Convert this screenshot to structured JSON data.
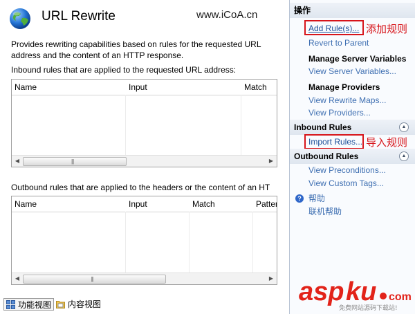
{
  "main": {
    "title": "URL Rewrite",
    "watermark": "www.iCoA.cn",
    "description": "Provides rewriting capabilities based on rules for the requested URL address and the content of an HTTP response.",
    "inbound_label": "Inbound rules that are applied to the requested URL address:",
    "inbound_columns": [
      "Name",
      "Input",
      "Match"
    ],
    "outbound_label": "Outbound rules that are applied to the headers or the content of an HT",
    "outbound_columns": [
      "Name",
      "Input",
      "Match",
      "Patter"
    ]
  },
  "bottom_tabs": {
    "feature_view": "功能视图",
    "content_view": "内容视图"
  },
  "actions": {
    "header": "操作",
    "add_rules": "Add Rule(s)...",
    "add_rules_note": "添加规则",
    "revert_to_parent": "Revert to Parent",
    "manage_server_variables": "Manage Server Variables",
    "view_server_variables": "View Server Variables...",
    "manage_providers": "Manage Providers",
    "view_rewrite_maps": "View Rewrite Maps...",
    "view_providers": "View Providers...",
    "inbound_rules": "Inbound Rules",
    "import_rules": "Import Rules...",
    "import_rules_note": "导入规则",
    "outbound_rules": "Outbound Rules",
    "view_preconditions": "View Preconditions...",
    "view_custom_tags": "View Custom Tags...",
    "help": "帮助",
    "online_help": "联机帮助"
  },
  "brand": {
    "logo_text": "aspku.com",
    "tagline": "免费网站源码下载站!"
  },
  "colors": {
    "link": "#3d6eb1",
    "annotation_red": "#d7141a",
    "section_bg": "#e4eaf2"
  }
}
